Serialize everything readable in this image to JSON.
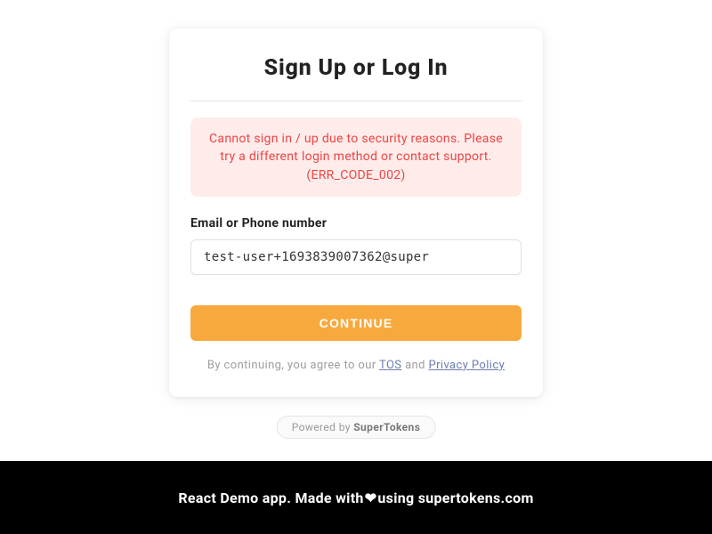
{
  "card": {
    "title": "Sign Up or Log In",
    "error_message": "Cannot sign in / up due to security reasons. Please try a different login method or contact support. (ERR_CODE_002)",
    "input_label": "Email or Phone number",
    "input_value": "test-user+1693839007362@super",
    "continue_label": "CONTINUE",
    "consent_prefix": "By continuing, you agree to our ",
    "tos_label": "TOS",
    "consent_mid": " and ",
    "privacy_label": "Privacy Policy"
  },
  "powered": {
    "prefix": "Powered by ",
    "brand": "SuperTokens"
  },
  "footer": {
    "prefix": "React Demo app. Made with",
    "heart": "❤",
    "suffix": "using supertokens.com"
  }
}
